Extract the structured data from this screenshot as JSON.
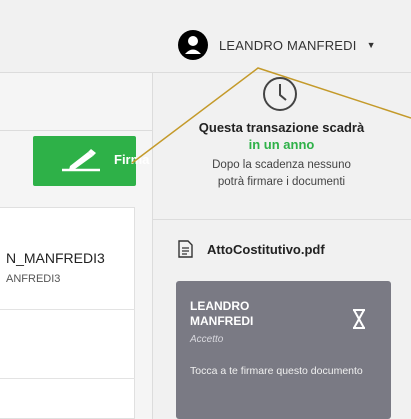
{
  "header": {
    "user_name": "LEANDRO MANFREDI",
    "caret": "▼"
  },
  "actions": {
    "sign_button_label": "Firma"
  },
  "document_list": {
    "title": "N_MANFREDI3",
    "subtitle": "ANFREDI3"
  },
  "expiry": {
    "title": "Questa transazione scadrà",
    "highlight": "in un anno",
    "note": "Dopo la scadenza nessuno potrà firmare i documenti"
  },
  "file": {
    "name": "AttoCostitutivo.pdf"
  },
  "signer": {
    "name": "LEANDRO MANFREDI",
    "status": "Accetto",
    "message": "Tocca a te firmare questo documento"
  },
  "colors": {
    "accent_green": "#2eb148",
    "signer_card": "#7a7a84",
    "annotation_line": "#c49a2a"
  },
  "icons": {
    "avatar": "user-avatar-icon",
    "clock": "clock-icon",
    "file": "document-icon",
    "pen": "pen-icon",
    "hourglass": "hourglass-icon"
  }
}
